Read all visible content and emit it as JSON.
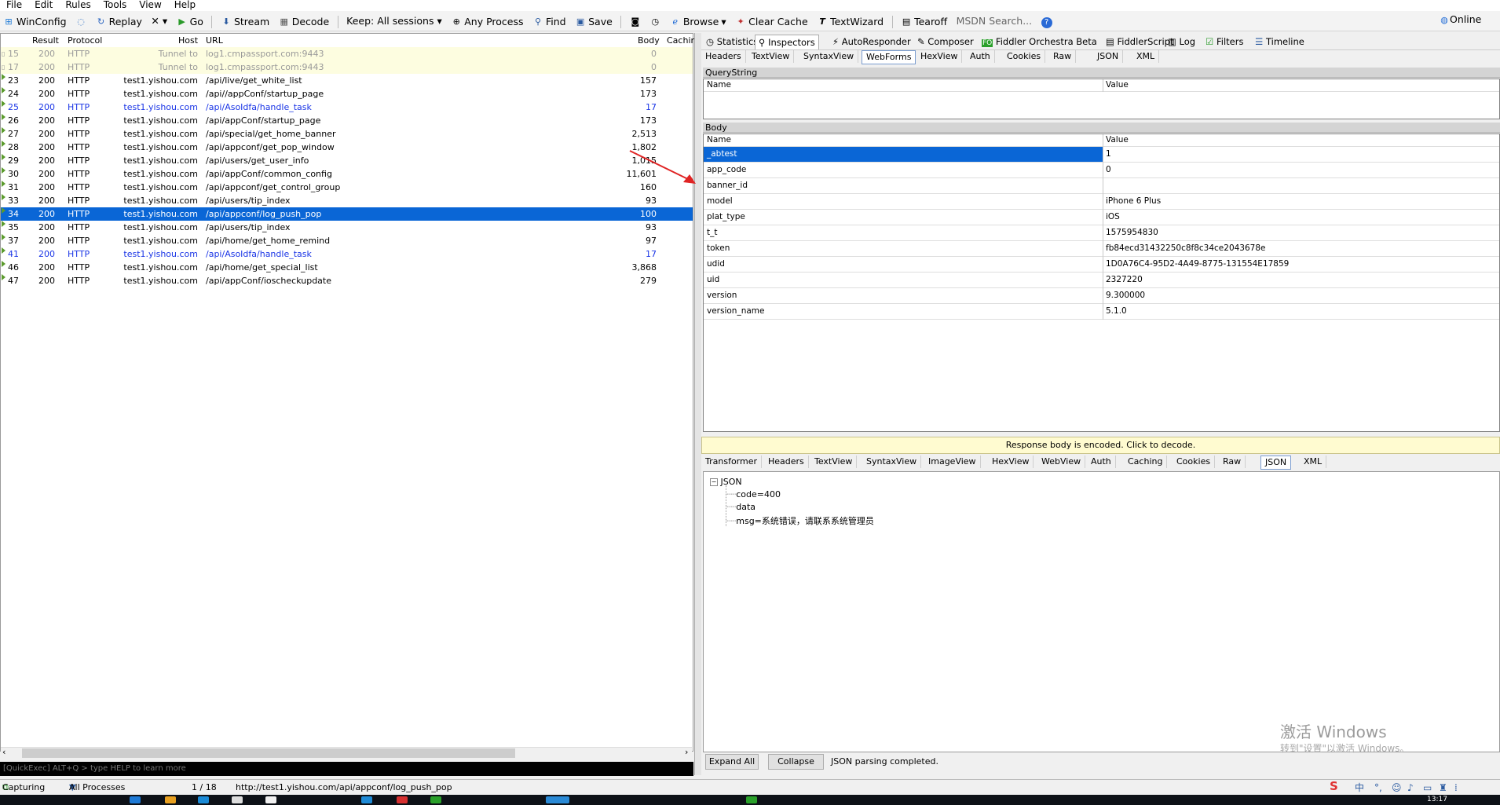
{
  "menu": [
    "File",
    "Edit",
    "Rules",
    "Tools",
    "View",
    "Help"
  ],
  "toolbar": {
    "winconfig": "WinConfig",
    "replay": "Replay",
    "remove": "✕ ▾",
    "go": "Go",
    "stream": "Stream",
    "decode": "Decode",
    "keep": "Keep: All sessions ▾",
    "any_process": "Any Process",
    "find": "Find",
    "save": "Save",
    "browse": "Browse",
    "clear_cache": "Clear Cache",
    "textwizard": "TextWizard",
    "tearoff": "Tearoff",
    "msdn_search": "MSDN Search...",
    "online": "Online"
  },
  "session_columns": [
    "Result",
    "Protocol",
    "Host",
    "URL",
    "Body",
    "Caching"
  ],
  "sessions": [
    {
      "num": "15",
      "result": "200",
      "protocol": "HTTP",
      "host": "Tunnel to",
      "url": "log1.cmpassport.com:9443",
      "body": "0",
      "style": "tunnel",
      "icon": "lock"
    },
    {
      "num": "17",
      "result": "200",
      "protocol": "HTTP",
      "host": "Tunnel to",
      "url": "log1.cmpassport.com:9443",
      "body": "0",
      "style": "tunnel",
      "icon": "lock"
    },
    {
      "num": "23",
      "result": "200",
      "protocol": "HTTP",
      "host": "test1.yishou.com",
      "url": "/api/live/get_white_list",
      "body": "157",
      "style": "",
      "icon": "arrow"
    },
    {
      "num": "24",
      "result": "200",
      "protocol": "HTTP",
      "host": "test1.yishou.com",
      "url": "/api//appConf/startup_page",
      "body": "173",
      "style": "",
      "icon": "arrow"
    },
    {
      "num": "25",
      "result": "200",
      "protocol": "HTTP",
      "host": "test1.yishou.com",
      "url": "/api/AsoIdfa/handle_task",
      "body": "17",
      "style": "blue",
      "icon": "arrow"
    },
    {
      "num": "26",
      "result": "200",
      "protocol": "HTTP",
      "host": "test1.yishou.com",
      "url": "/api/appConf/startup_page",
      "body": "173",
      "style": "",
      "icon": "arrow"
    },
    {
      "num": "27",
      "result": "200",
      "protocol": "HTTP",
      "host": "test1.yishou.com",
      "url": "/api/special/get_home_banner",
      "body": "2,513",
      "style": "",
      "icon": "arrow"
    },
    {
      "num": "28",
      "result": "200",
      "protocol": "HTTP",
      "host": "test1.yishou.com",
      "url": "/api/appconf/get_pop_window",
      "body": "1,802",
      "style": "",
      "icon": "arrow"
    },
    {
      "num": "29",
      "result": "200",
      "protocol": "HTTP",
      "host": "test1.yishou.com",
      "url": "/api/users/get_user_info",
      "body": "1,015",
      "style": "",
      "icon": "arrow"
    },
    {
      "num": "30",
      "result": "200",
      "protocol": "HTTP",
      "host": "test1.yishou.com",
      "url": "/api/appConf/common_config",
      "body": "11,601",
      "style": "",
      "icon": "arrow"
    },
    {
      "num": "31",
      "result": "200",
      "protocol": "HTTP",
      "host": "test1.yishou.com",
      "url": "/api/appconf/get_control_group",
      "body": "160",
      "style": "",
      "icon": "arrow"
    },
    {
      "num": "33",
      "result": "200",
      "protocol": "HTTP",
      "host": "test1.yishou.com",
      "url": "/api/users/tip_index",
      "body": "93",
      "style": "",
      "icon": "arrow"
    },
    {
      "num": "34",
      "result": "200",
      "protocol": "HTTP",
      "host": "test1.yishou.com",
      "url": "/api/appconf/log_push_pop",
      "body": "100",
      "style": "sel",
      "icon": "arrow"
    },
    {
      "num": "35",
      "result": "200",
      "protocol": "HTTP",
      "host": "test1.yishou.com",
      "url": "/api/users/tip_index",
      "body": "93",
      "style": "",
      "icon": "arrow"
    },
    {
      "num": "37",
      "result": "200",
      "protocol": "HTTP",
      "host": "test1.yishou.com",
      "url": "/api/home/get_home_remind",
      "body": "97",
      "style": "",
      "icon": "arrow"
    },
    {
      "num": "41",
      "result": "200",
      "protocol": "HTTP",
      "host": "test1.yishou.com",
      "url": "/api/AsoIdfa/handle_task",
      "body": "17",
      "style": "blue",
      "icon": "arrow"
    },
    {
      "num": "46",
      "result": "200",
      "protocol": "HTTP",
      "host": "test1.yishou.com",
      "url": "/api/home/get_special_list",
      "body": "3,868",
      "style": "",
      "icon": "arrow"
    },
    {
      "num": "47",
      "result": "200",
      "protocol": "HTTP",
      "host": "test1.yishou.com",
      "url": "/api/appConf/ioscheckupdate",
      "body": "279",
      "style": "",
      "icon": "arrow"
    }
  ],
  "quickexec": "[QuickExec] ALT+Q > type HELP to learn more",
  "main_tabs": [
    "Statistics",
    "Inspectors",
    "AutoResponder",
    "Composer",
    "Fiddler Orchestra Beta",
    "FiddlerScript",
    "Log",
    "Filters",
    "Timeline"
  ],
  "request_tabs": [
    "Headers",
    "TextView",
    "SyntaxView",
    "WebForms",
    "HexView",
    "Auth",
    "Cookies",
    "Raw",
    "JSON",
    "XML"
  ],
  "querystring": {
    "title": "QueryString",
    "col_name": "Name",
    "col_value": "Value"
  },
  "body_section": {
    "title": "Body",
    "col_name": "Name",
    "col_value": "Value",
    "rows": [
      {
        "name": "_abtest",
        "value": "1"
      },
      {
        "name": "app_code",
        "value": "0"
      },
      {
        "name": "banner_id",
        "value": ""
      },
      {
        "name": "model",
        "value": "iPhone 6 Plus"
      },
      {
        "name": "plat_type",
        "value": "iOS"
      },
      {
        "name": "t_t",
        "value": "1575954830"
      },
      {
        "name": "token",
        "value": "fb84ecd31432250c8f8c34ce2043678e"
      },
      {
        "name": "udid",
        "value": "1D0A76C4-95D2-4A49-8775-131554E17859"
      },
      {
        "name": "uid",
        "value": "2327220"
      },
      {
        "name": "version",
        "value": "9.300000"
      },
      {
        "name": "version_name",
        "value": "5.1.0"
      }
    ]
  },
  "decode_bar": "Response body is encoded. Click to decode.",
  "response_tabs": [
    "Transformer",
    "Headers",
    "TextView",
    "SyntaxView",
    "ImageView",
    "HexView",
    "WebView",
    "Auth",
    "Caching",
    "Cookies",
    "Raw",
    "JSON",
    "XML"
  ],
  "json_tree": {
    "root": "JSON",
    "children": [
      "code=400",
      "data",
      "msg=系统错误，请联系系统管理员"
    ]
  },
  "buttons": {
    "expand_all": "Expand All",
    "collapse": "Collapse",
    "status": "JSON parsing completed."
  },
  "watermark": {
    "line1": "激活 Windows",
    "line2": "转到\"设置\"以激活 Windows。"
  },
  "statusbar": {
    "capturing": "Capturing",
    "processes": "All Processes",
    "count": "1 / 18",
    "url": "http://test1.yishou.com/api/appconf/log_push_pop"
  },
  "tray": {
    "ime": "中",
    "time": "13:17"
  },
  "colors": {
    "selection": "#0a66d6",
    "tunnel_bg": "#fdfde0",
    "blue_row": "#1a35e6",
    "arrow_red": "#e02424"
  }
}
